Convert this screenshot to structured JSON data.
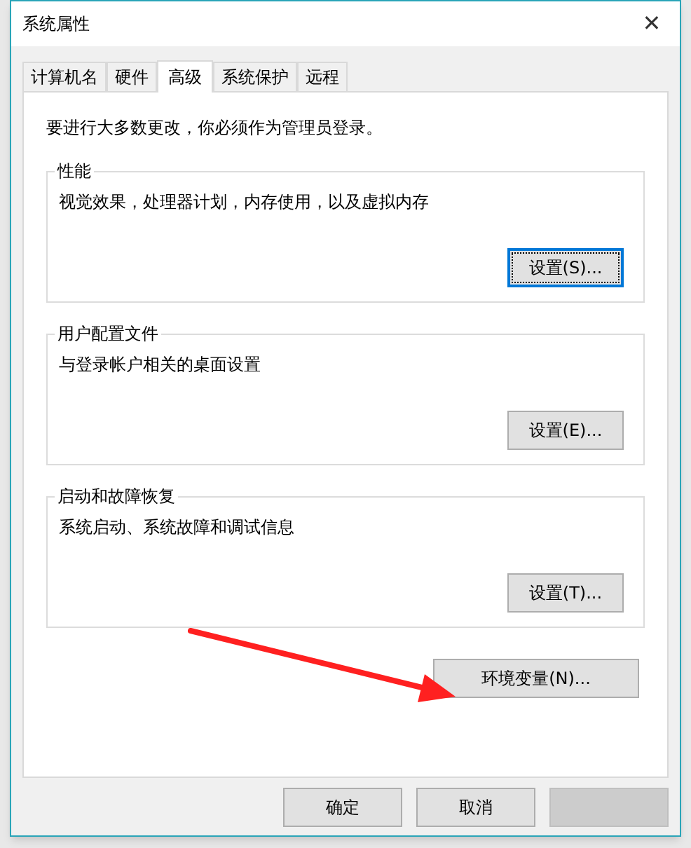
{
  "window": {
    "title": "系统属性",
    "close": "✕"
  },
  "tabs": [
    {
      "label": "计算机名",
      "selected": false
    },
    {
      "label": "硬件",
      "selected": false
    },
    {
      "label": "高级",
      "selected": true
    },
    {
      "label": "系统保护",
      "selected": false
    },
    {
      "label": "远程",
      "selected": false
    }
  ],
  "notice": "要进行大多数更改，你必须作为管理员登录。",
  "groups": [
    {
      "title": "性能",
      "description": "视觉效果，处理器计划，内存使用，以及虚拟内存",
      "button": {
        "label": "设置(S)...",
        "focused": true
      }
    },
    {
      "title": "用户配置文件",
      "description": "与登录帐户相关的桌面设置",
      "button": {
        "label": "设置(E)...",
        "focused": false
      }
    },
    {
      "title": "启动和故障恢复",
      "description": "系统启动、系统故障和调试信息",
      "button": {
        "label": "设置(T)...",
        "focused": false
      }
    }
  ],
  "env_button": "环境变量(N)...",
  "footer_buttons": [
    {
      "label": "确定",
      "disabled": false
    },
    {
      "label": "取消",
      "disabled": false
    },
    {
      "disabled": true
    }
  ]
}
